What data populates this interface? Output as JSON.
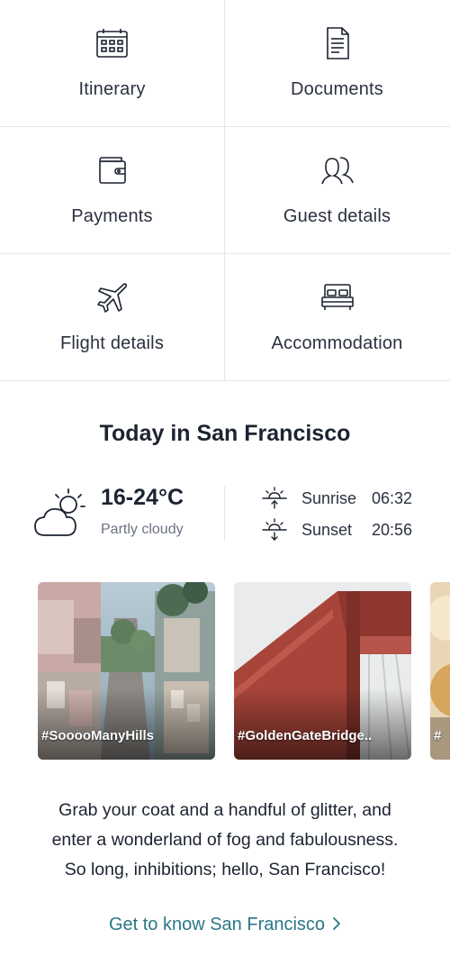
{
  "menu": {
    "tiles": [
      {
        "label": "Itinerary",
        "icon": "calendar-icon"
      },
      {
        "label": "Documents",
        "icon": "document-icon"
      },
      {
        "label": "Payments",
        "icon": "wallet-icon"
      },
      {
        "label": "Guest details",
        "icon": "guests-icon"
      },
      {
        "label": "Flight details",
        "icon": "plane-icon"
      },
      {
        "label": "Accommodation",
        "icon": "bed-icon"
      }
    ]
  },
  "today": {
    "title": "Today in San Francisco",
    "weather": {
      "temperature": "16-24°C",
      "condition": "Partly cloudy",
      "icon": "partly-cloudy-icon"
    },
    "sunrise": {
      "label": "Sunrise",
      "time": "06:32",
      "icon": "sunrise-icon"
    },
    "sunset": {
      "label": "Sunset",
      "time": "20:56",
      "icon": "sunset-icon"
    }
  },
  "photos": [
    {
      "tag": "#SooooManyHills"
    },
    {
      "tag": "#GoldenGateBridge.."
    },
    {
      "tag": "#"
    }
  ],
  "blurb": {
    "line1": "Grab your coat and a handful of glitter, and",
    "line2": "enter a wonderland of fog and fabulousness.",
    "line3": "So long, inhibitions; hello, San Francisco!"
  },
  "cta": {
    "label": "Get to know San Francisco"
  },
  "colors": {
    "text": "#1c2331",
    "accent": "#2a7787",
    "divider": "#e4e6ea"
  }
}
